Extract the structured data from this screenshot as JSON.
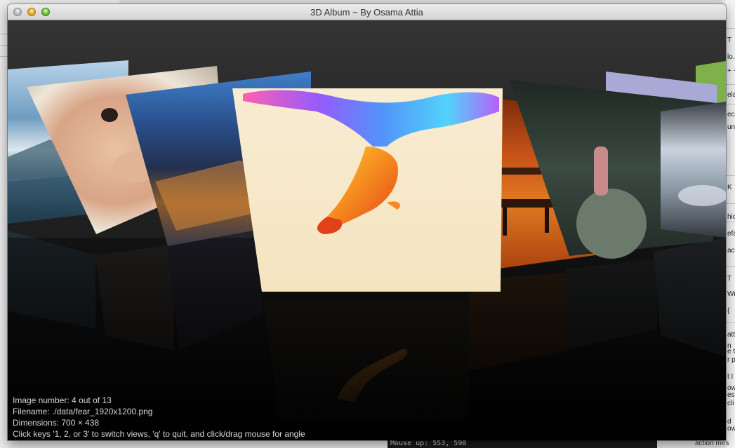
{
  "window": {
    "title": "3D Album ~ By Osama Attia",
    "buttons": [
      "close",
      "minimize",
      "zoom"
    ]
  },
  "album": {
    "photos": [
      {
        "subject": "mountain lake landscape",
        "colors": [
          "#9fc2e0",
          "#3f6d8c",
          "#dfe9ef"
        ]
      },
      {
        "subject": "baby in white hooded towel",
        "colors": [
          "#f1e6d6",
          "#d9a98a",
          "#7a6a5a"
        ]
      },
      {
        "subject": "city at night aerial view",
        "colors": [
          "#3a6fb0",
          "#1c2b4f",
          "#e89a3a"
        ]
      },
      {
        "subject": "koi fish with rainbow tail",
        "colors": [
          "#f7ecd3",
          "#f07a1c",
          "#7a3cff"
        ]
      },
      {
        "subject": "autumn park benches",
        "colors": [
          "#d96a1a",
          "#7a2a08",
          "#3b1a08"
        ]
      },
      {
        "subject": "alien character on globe",
        "colors": [
          "#2b3a33",
          "#5b6b5f",
          "#c88a8a"
        ]
      },
      {
        "subject": "silver sports car",
        "colors": [
          "#8a9aa8",
          "#dfe6ee",
          "#2c2c34"
        ]
      },
      {
        "subject": "green field",
        "colors": [
          "#7fb04a",
          "#cfe0b0"
        ]
      },
      {
        "subject": "purple sky",
        "colors": [
          "#a8a8d8",
          "#d8d8ee"
        ]
      }
    ]
  },
  "status": {
    "image_number": "Image number: 4 out of 13",
    "filename": "Filename: ./data/fear_1920x1200.png",
    "dimensions": "Dimensions: 700 × 438",
    "help": "Click keys '1, 2, or 3' to switch views, 'q' to quit, and click/drag mouse for angle"
  },
  "background_windows": {
    "terminal_text": "Mouse up: 553, 598",
    "right_snippets": [
      "T",
      "lo.c",
      "+ +",
      "ela",
      "ec",
      "un",
      "K",
      "hic",
      "efa",
      "ac",
      "T",
      "Wr",
      "{",
      "atti",
      "n",
      "e to",
      "r p",
      "t I",
      "ow",
      "ess",
      "cli",
      "d",
      "ow",
      "action mes"
    ]
  }
}
